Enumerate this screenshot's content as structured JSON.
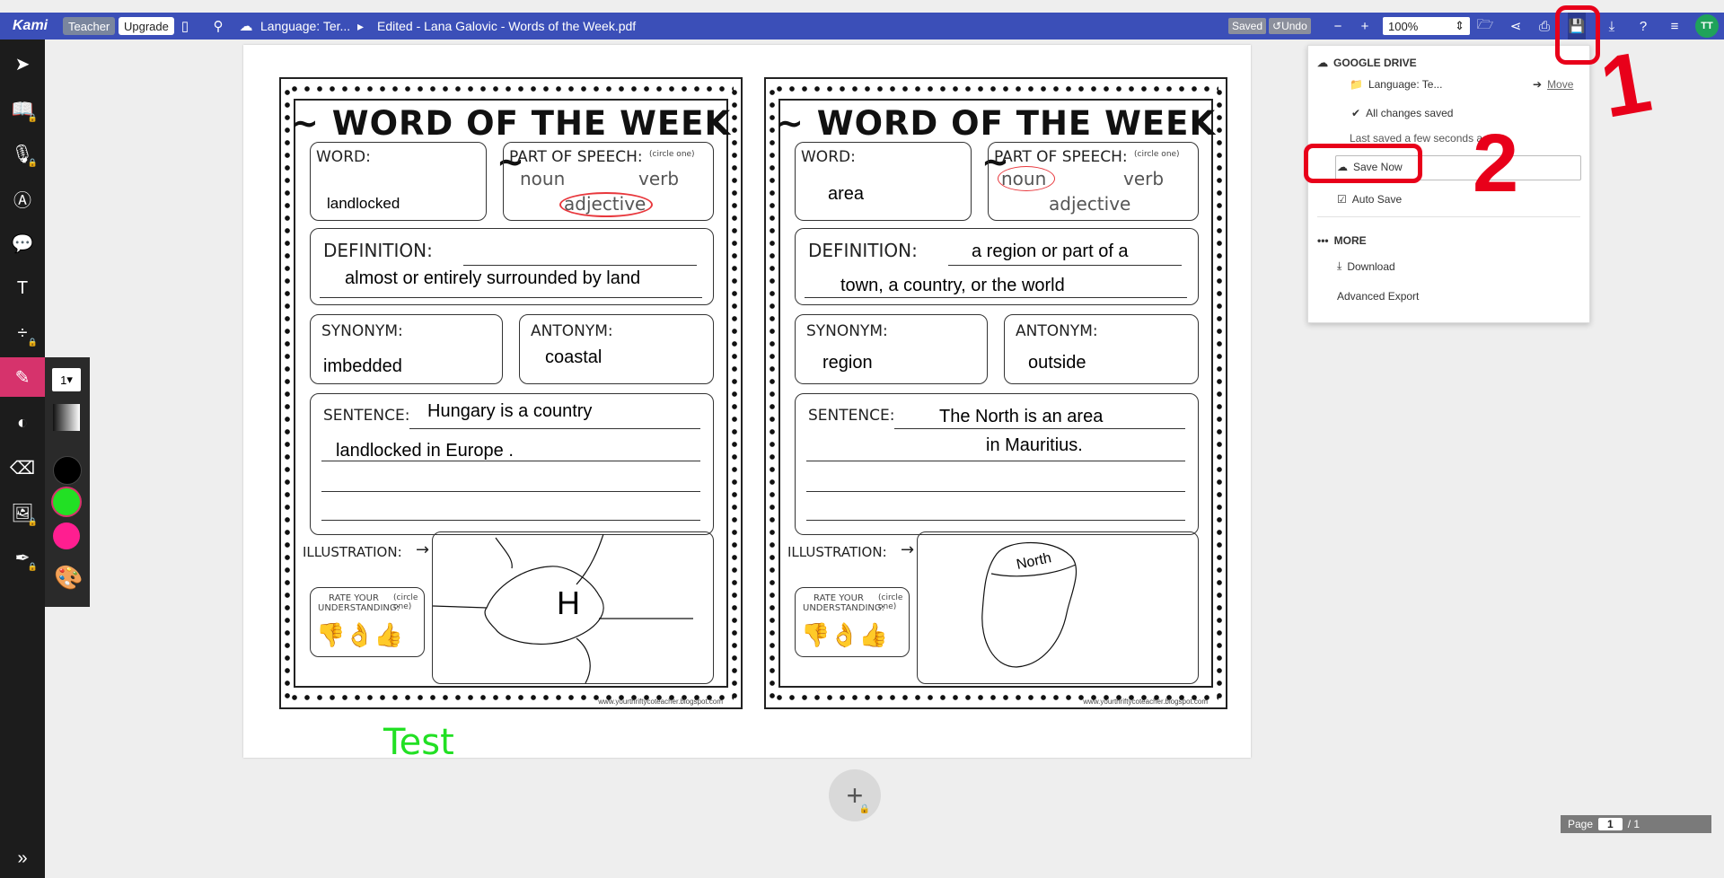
{
  "topbar": {
    "logo": "Kami",
    "teacher": "Teacher",
    "upgrade": "Upgrade",
    "folder_crumb": "Language: Ter...",
    "file_name": "Edited - Lana Galovic - Words of the Week.pdf",
    "saved": "Saved",
    "undo": "Undo",
    "zoom": "100%",
    "avatar": "TT"
  },
  "toolbar": {
    "size_value": "1",
    "colors": [
      "#000000",
      "#22e024",
      "#ff1e90"
    ],
    "accent": "#d6336c"
  },
  "document": {
    "left": {
      "title": "~ WORD OF THE WEEK ~",
      "word_label": "WORD:",
      "word": "landlocked",
      "pos_label": "PART OF SPEECH:",
      "pos_hint": "(circle one)",
      "pos_noun": "noun",
      "pos_verb": "verb",
      "pos_adjective": "adjective",
      "definition_label": "DEFINITION:",
      "definition": "almost or entirely surrounded by land",
      "synonym_label": "SYNONYM:",
      "synonym": "imbedded",
      "antonym_label": "ANTONYM:",
      "antonym": "coastal",
      "sentence_label": "SENTENCE:",
      "sentence_1": "Hungary is a country",
      "sentence_2": "landlocked in Europe .",
      "illustration_label": "ILLUSTRATION:",
      "rate_label": "RATE YOUR UNDERSTANDING:",
      "rate_hint": "(circle one)",
      "drawing_text": "H",
      "footer": "www.yourthriftycoteacher.blogspot.com"
    },
    "right": {
      "title": "~ WORD OF THE WEEK ~",
      "word_label": "WORD:",
      "word": "area",
      "pos_label": "PART OF SPEECH:",
      "pos_hint": "(circle one)",
      "pos_noun": "noun",
      "pos_verb": "verb",
      "pos_adjective": "adjective",
      "definition_label": "DEFINITION:",
      "definition_1": "a region or part of a",
      "definition_2": "town, a country, or the world",
      "synonym_label": "SYNONYM:",
      "synonym": "region",
      "antonym_label": "ANTONYM:",
      "antonym": "outside",
      "sentence_label": "SENTENCE:",
      "sentence_1": "The North is an area",
      "sentence_2": "in Mauritius.",
      "illustration_label": "ILLUSTRATION:",
      "rate_label": "RATE YOUR UNDERSTANDING:",
      "rate_hint": "(circle one)",
      "drawing_text": "North",
      "footer": "www.yourthriftycoteacher.blogspot.com"
    },
    "annotation_text": "Test"
  },
  "dropdown": {
    "section_drive": "GOOGLE DRIVE",
    "folder": "Language: Te...",
    "move": "Move",
    "all_saved": "All changes saved",
    "last_saved": "Last saved a few seconds ago",
    "save_now": "Save Now",
    "auto_save": "Auto Save",
    "section_more": "MORE",
    "download": "Download",
    "advanced_export": "Advanced Export"
  },
  "annotations": {
    "one": "1",
    "two": "2"
  },
  "pager": {
    "label": "Page",
    "current": "1",
    "total": "/ 1"
  }
}
